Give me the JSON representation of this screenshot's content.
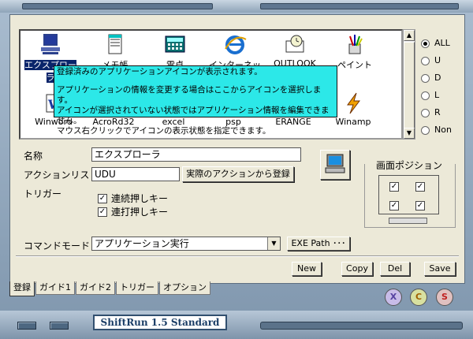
{
  "icons": {
    "items": [
      {
        "label": "エクスプローラ",
        "icon": "explorer-icon"
      },
      {
        "label": "メモ帳",
        "icon": "notepad-icon"
      },
      {
        "label": "電卓",
        "icon": "calculator-icon"
      },
      {
        "label": "インターネット",
        "icon": "internet-explorer-icon"
      },
      {
        "label": "OUTLOOK",
        "icon": "outlook-icon"
      },
      {
        "label": "ペイント",
        "icon": "paint-icon"
      },
      {
        "label": "Winword",
        "icon": "word-icon"
      },
      {
        "label": "AcroRd32",
        "icon": "acrobat-icon"
      },
      {
        "label": "excel",
        "icon": "excel-icon"
      },
      {
        "label": "psp",
        "icon": "psp-icon"
      },
      {
        "label": "ERANGE",
        "icon": "erange-icon"
      },
      {
        "label": "Winamp",
        "icon": "winamp-icon"
      }
    ],
    "tooltip_line1": "登録済みのアプリケーションアイコンが表示されます。",
    "tooltip_line2": "アプリケーションの情報を変更する場合はここからアイコンを選択します。",
    "tooltip_line3": "アイコンが選択されていない状態ではアプリケーション情報を編集できません。",
    "tooltip_line4": "マウス右クリックでアイコンの表示状態を指定できます。"
  },
  "filters": [
    "ALL",
    "U",
    "D",
    "L",
    "R",
    "Non"
  ],
  "form": {
    "name_label": "名称",
    "name_value": "エクスプローラ",
    "action_label": "アクションリスト",
    "action_value": "UDU",
    "register_from_action": "実際のアクションから登録",
    "trigger_label": "トリガー",
    "trigger_opt1": "連続押しキー",
    "trigger_opt2": "連打押しキー",
    "command_label": "コマンドモード",
    "command_value": "アプリケーション実行",
    "exe_path": "EXE Path ･･･"
  },
  "position": {
    "title": "画面ポジション"
  },
  "buttons": {
    "new": "New",
    "copy": "Copy",
    "del": "Del",
    "save": "Save"
  },
  "tabs": [
    "登録",
    "ガイド1",
    "ガイド2",
    "トリガー",
    "オプション"
  ],
  "circles": {
    "x": "X",
    "c": "C",
    "s": "S"
  },
  "brand": "ShiftRun 1.5 Standard"
}
